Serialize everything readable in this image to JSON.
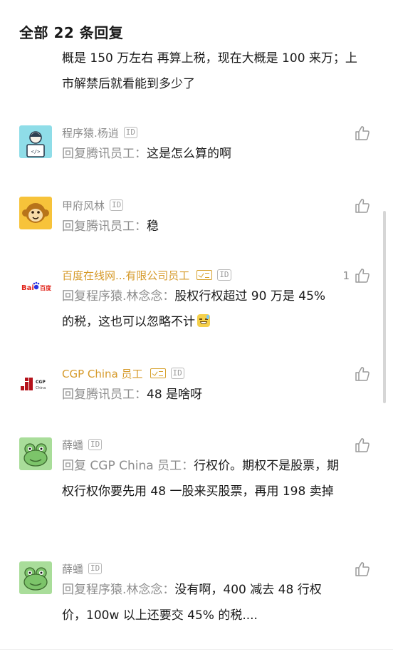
{
  "header": {
    "title": "全部 22 条回复"
  },
  "previous_reply_tail": "概是 150 万左右 再算上税，现在大概是 100 来万；上市解禁后就看能到多少了",
  "replies": [
    {
      "author": "程序猿.杨逍",
      "reply_to_prefix": "回复腾讯员工：",
      "text": "这是怎么算的啊",
      "avatar": "coder-avatar-icon",
      "like_count": ""
    },
    {
      "author": "甲府风林",
      "reply_to_prefix": "回复腾讯员工：",
      "text": "稳",
      "avatar": "monkey-avatar-icon",
      "like_count": ""
    },
    {
      "author": "百度在线网...有限公司员工",
      "reply_to_prefix": "回复程序猿.林念念：",
      "text": "股权行权超过 90 万是 45% 的税，这也可以忽略不计",
      "avatar": "baidu-logo-icon",
      "like_count": "1",
      "company_color": "#d69a2a"
    },
    {
      "author": "CGP China 员工",
      "reply_to_prefix": "回复腾讯员工：",
      "text": "48 是啥呀",
      "avatar": "cgp-china-logo-icon",
      "like_count": "",
      "company_color": "#d69a2a"
    },
    {
      "author": "薛蟠",
      "reply_to_prefix": "回复 CGP China 员工：",
      "text": "行权价。期权不是股票，期权行权你要先用 48 一股来买股票，再用 198 卖掉",
      "avatar": "frog-avatar-icon",
      "like_count": ""
    },
    {
      "author": "薛蟠",
      "reply_to_prefix": "回复程序猿.林念念：",
      "text": "没有啊，400 减去 48 行权价，100w 以上还要交 45% 的税....",
      "avatar": "frog-avatar-icon",
      "like_count": ""
    }
  ],
  "badges": {
    "id": "ID"
  },
  "colors": {
    "company_name": "#d69a2a",
    "muted": "#8d8d8d",
    "text": "#1a1a1a"
  }
}
